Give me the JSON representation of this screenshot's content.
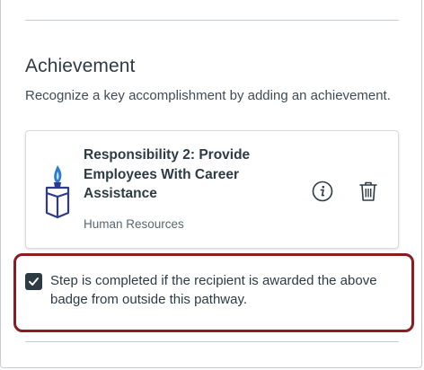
{
  "section": {
    "title": "Achievement",
    "description": "Recognize a key accomplishment by adding an achievement."
  },
  "badge": {
    "title": "Responsibility 2: Provide Employees With Career Assistance",
    "organization": "Human Resources",
    "icon": "badge-torch-icon",
    "actions": {
      "info_icon": "info-icon",
      "delete_icon": "trash-icon"
    }
  },
  "completion_option": {
    "checked": true,
    "label": "Step is completed if the recipient is awarded the above badge from outside this pathway."
  },
  "colors": {
    "highlight_border": "#8a1c22",
    "checkbox_fill": "#2d3b45",
    "text": "#2d3b45",
    "badge_blue": "#2f3a8f",
    "flame_blue": "#2b7bd6"
  }
}
